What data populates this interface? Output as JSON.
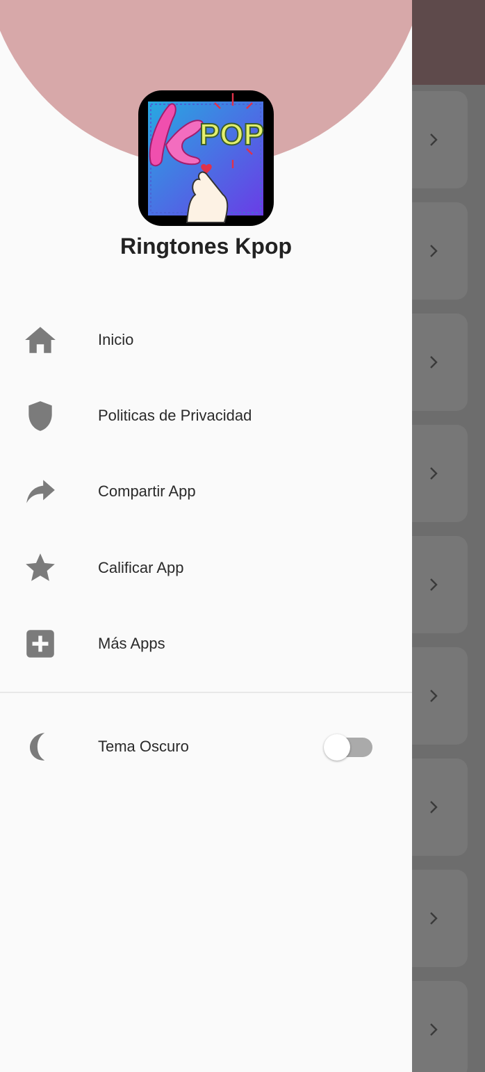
{
  "app": {
    "title": "Ringtones Kpop",
    "logo_letter": "K",
    "logo_text": "POP"
  },
  "menu": {
    "items": [
      {
        "label": "Inicio",
        "icon": "home-icon"
      },
      {
        "label": "Politicas de Privacidad",
        "icon": "shield-icon"
      },
      {
        "label": "Compartir App",
        "icon": "share-icon"
      },
      {
        "label": "Calificar App",
        "icon": "star-icon"
      },
      {
        "label": "Más Apps",
        "icon": "plus-box-icon"
      }
    ]
  },
  "settings": {
    "dark_theme_label": "Tema Oscuro",
    "dark_theme_icon": "moon-icon",
    "dark_theme_enabled": false
  },
  "background": {
    "card_icon": "chevron-right-icon"
  },
  "colors": {
    "header_circle": "#d7a8a9",
    "drawer_bg": "#fafafa",
    "icon_gray": "#7b7b7b",
    "scrim": "#6d6d6d",
    "appbar_dim": "#5e4a4b"
  }
}
